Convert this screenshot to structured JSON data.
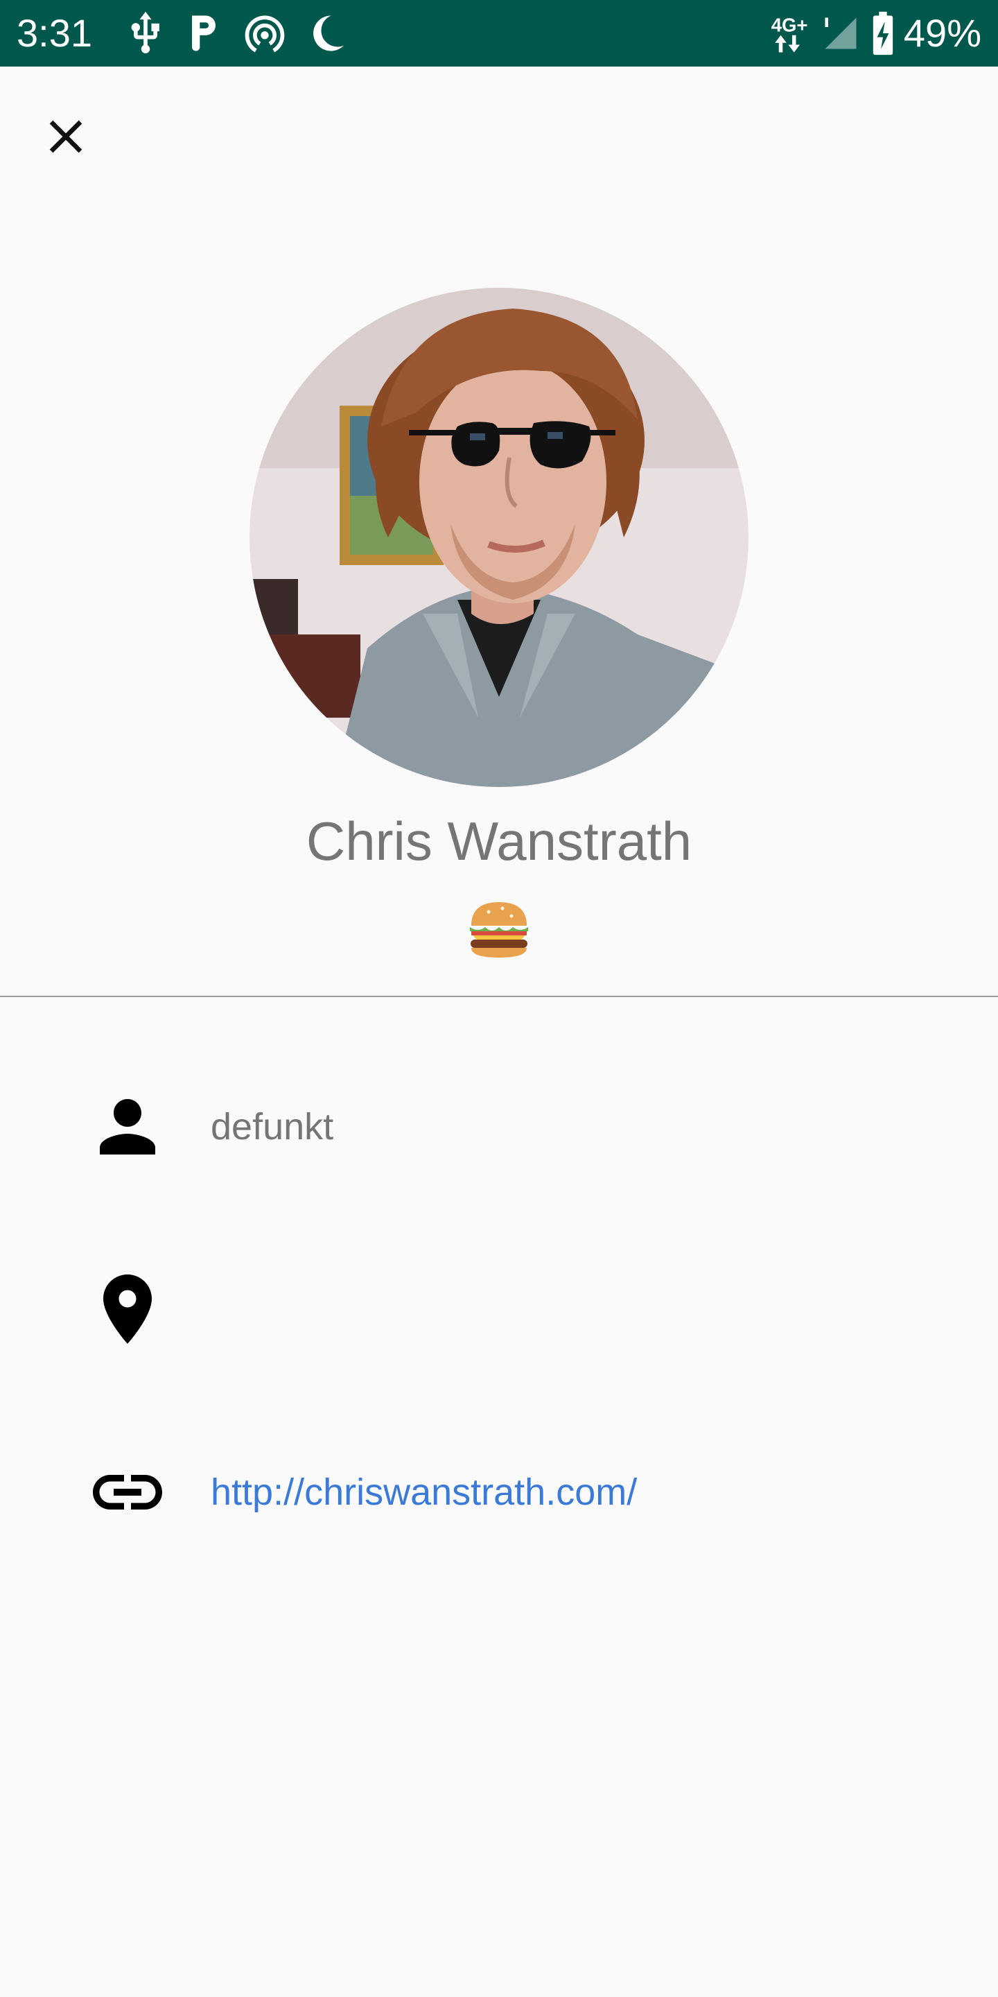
{
  "status_bar": {
    "time": "3:31",
    "network": "4G+",
    "battery": "49%",
    "background_color": "#00574b",
    "icons": [
      "usb-icon",
      "parking-icon",
      "hotspot-icon",
      "do-not-disturb-icon",
      "network-4g-icon",
      "signal-icon",
      "battery-charging-icon"
    ]
  },
  "toolbar": {
    "close_icon": "close-icon"
  },
  "profile": {
    "name": "Chris Wanstrath",
    "status_emoji": "hamburger-emoji",
    "username": "defunkt",
    "location": "",
    "website": "http://chriswanstrath.com/",
    "link_color": "#3b7ad6"
  },
  "rows": [
    {
      "icon": "person-icon",
      "text": "defunkt"
    },
    {
      "icon": "location-pin-icon",
      "text": ""
    },
    {
      "icon": "link-icon",
      "text": "http://chriswanstrath.com/"
    }
  ]
}
